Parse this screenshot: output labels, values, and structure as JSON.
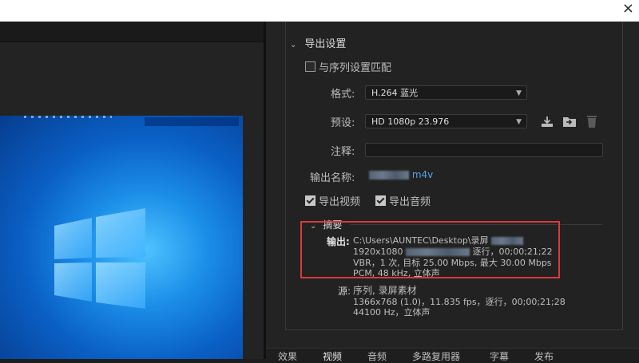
{
  "window": {
    "close_glyph": "×"
  },
  "export_settings": {
    "section_title": "导出设置",
    "match_sequence_label": "与序列设置匹配",
    "format_label": "格式:",
    "format_value": "H.264 蓝光",
    "preset_label": "预设:",
    "preset_value": "HD 1080p 23.976",
    "comment_label": "注释:",
    "output_name_label": "输出名称:",
    "output_name_suffix": "m4v",
    "export_video_label": "导出视频",
    "export_audio_label": "导出音频",
    "icons": [
      "save-preset-icon",
      "import-preset-icon",
      "delete-preset-icon"
    ]
  },
  "summary": {
    "title": "摘要",
    "output_key": "输出:",
    "output_lines": [
      "C:\\Users\\AUNTEC\\Desktop\\录屏",
      "1920x1080",
      "逐行，00;00;21;22",
      "VBR，1 次, 目标 25.00 Mbps, 最大 30.00 Mbps",
      "PCM, 48 kHz, 立体声"
    ],
    "source_key": "源:",
    "source_lines": [
      "序列, 录屏素材",
      "1366x768 (1.0)，11.835 fps，逐行，00;00;21;28",
      "44100 Hz，立体声"
    ]
  },
  "tabs": [
    "效果",
    "视频",
    "音频",
    "多路复用器",
    "字幕",
    "发布"
  ],
  "active_tab": "视频",
  "colors": {
    "highlight": "#d83b3b",
    "link": "#5aa0e6"
  }
}
